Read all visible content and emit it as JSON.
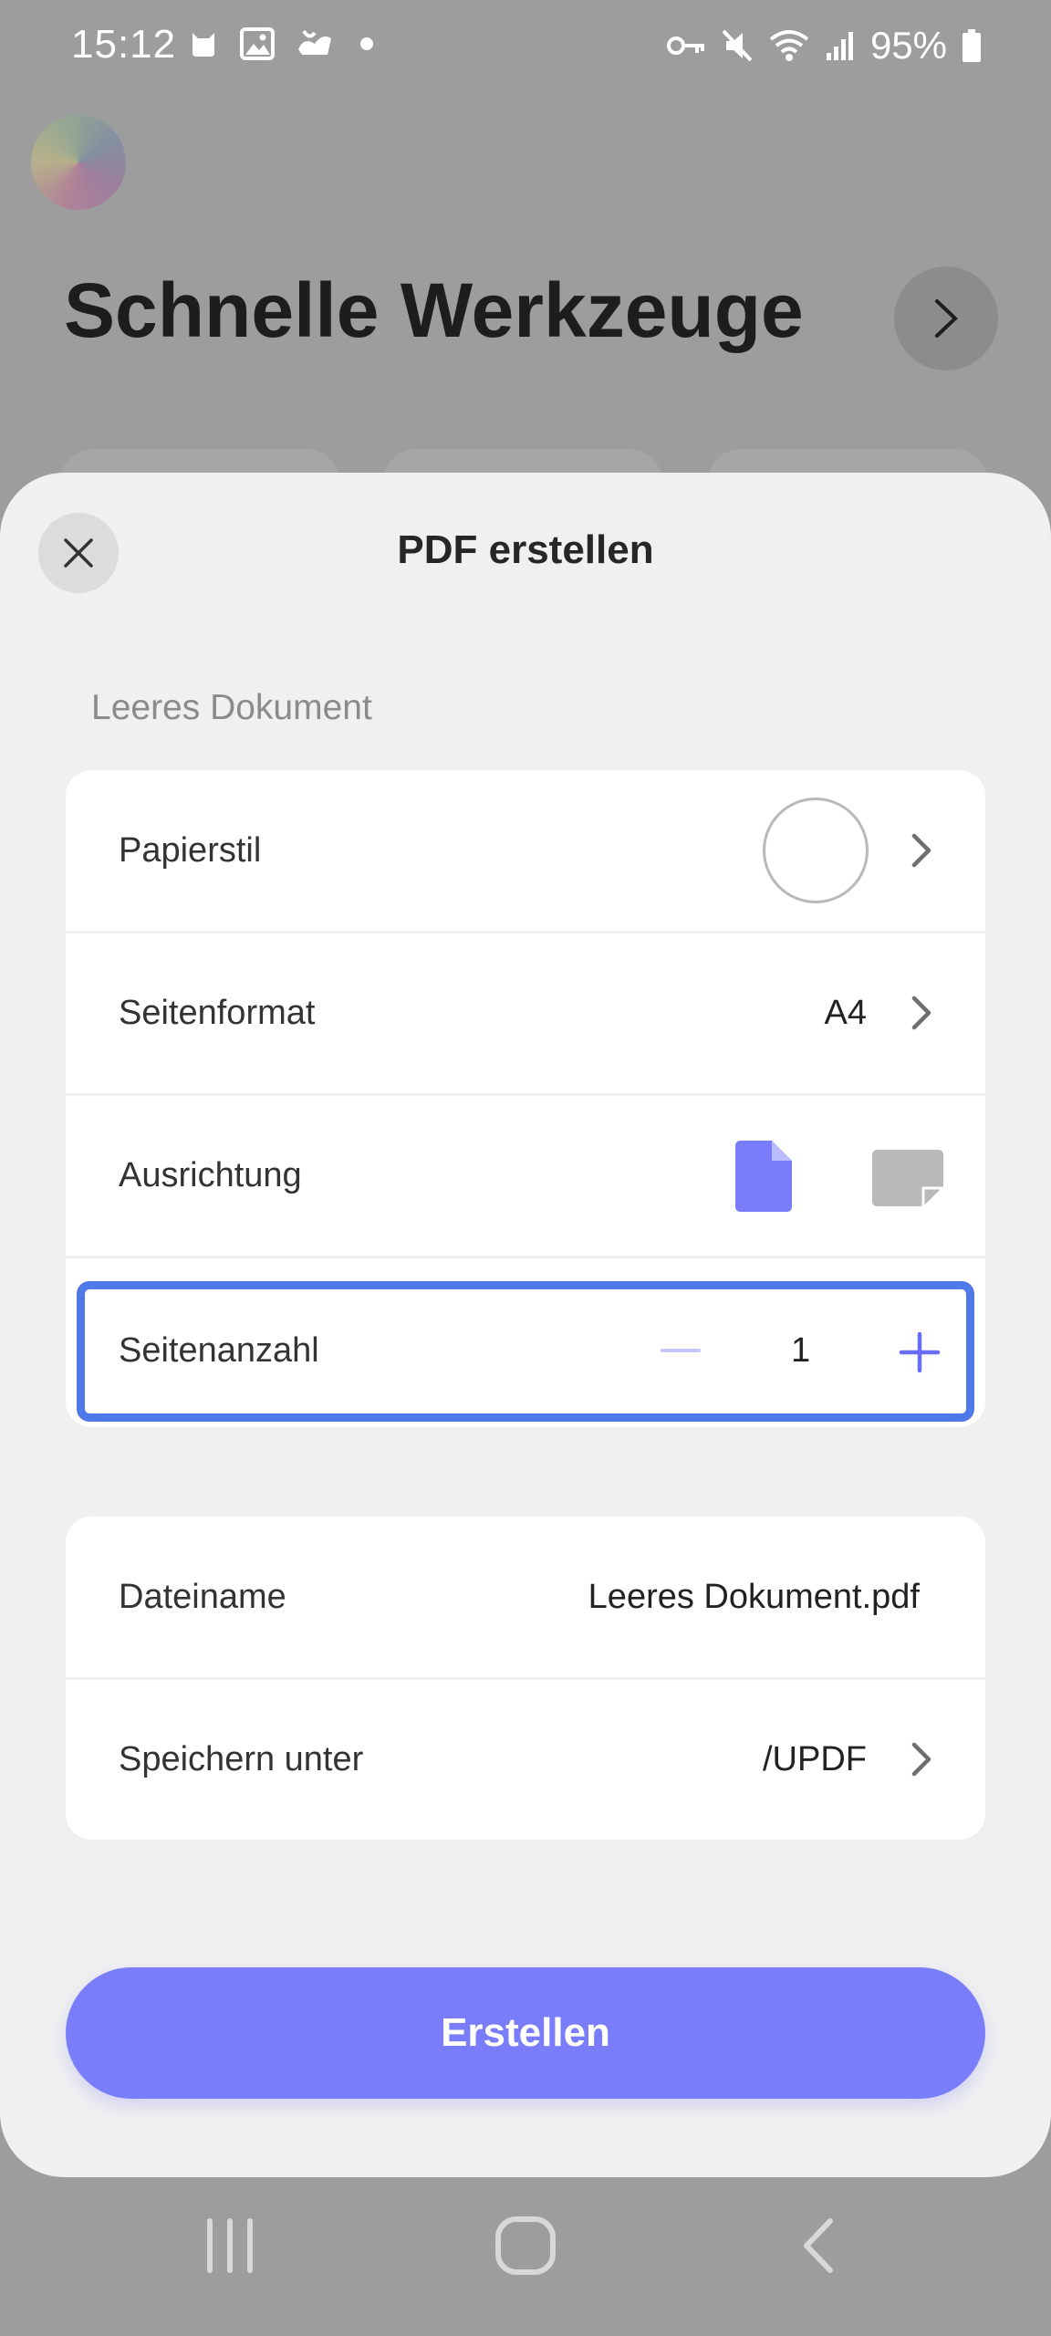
{
  "status_bar": {
    "time": "15:12",
    "battery": "95%",
    "icons_left": [
      "cat-notification-icon",
      "image-icon",
      "cloud-sync-icon",
      "dot-icon"
    ],
    "icons_right": [
      "vpn-key-icon",
      "mute-icon",
      "wifi-icon",
      "signal-icon",
      "battery-icon"
    ]
  },
  "background": {
    "title": "Schnelle Werkzeuge"
  },
  "sheet": {
    "title": "PDF erstellen",
    "section_label": "Leeres Dokument",
    "rows": {
      "paper_style": {
        "label": "Papierstil"
      },
      "page_format": {
        "label": "Seitenformat",
        "value": "A4"
      },
      "orientation": {
        "label": "Ausrichtung",
        "selected": "portrait"
      },
      "page_count": {
        "label": "Seitenanzahl",
        "value": "1"
      }
    },
    "file": {
      "name_label": "Dateiname",
      "name_value": "Leeres Dokument.pdf",
      "save_label": "Speichern unter",
      "save_value": "/UPDF"
    },
    "create_button": "Erstellen"
  },
  "colors": {
    "accent": "#7a7dfa",
    "focus_border": "#4f78e8",
    "sheet_bg": "#f0f0f0",
    "scrim": "#9d9d9d"
  }
}
